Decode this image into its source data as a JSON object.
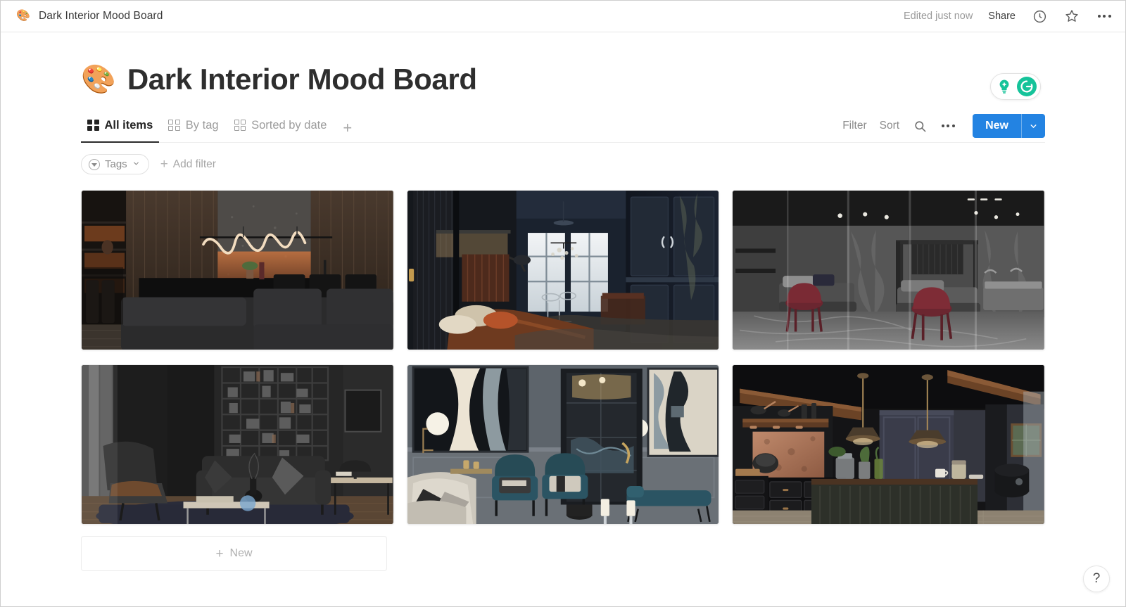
{
  "window": {
    "tab_title": "Dark Interior Mood Board",
    "favicon_icon": "artist-palette-emoji",
    "edited_status": "Edited just now",
    "share_label": "Share",
    "history_icon": "clock-icon",
    "favorite_icon": "star-icon",
    "more_icon": "ellipsis-icon"
  },
  "header": {
    "emoji": "🎨",
    "title": "Dark Interior Mood Board"
  },
  "assistant_widget": {
    "bulb_icon": "lightbulb-icon",
    "grammarly_letter": "G",
    "accent_color": "#15c39a"
  },
  "views": {
    "tabs": [
      {
        "label": "All items",
        "icon": "gallery-grid-icon",
        "active": true
      },
      {
        "label": "By tag",
        "icon": "gallery-grid-icon",
        "active": false
      },
      {
        "label": "Sorted by date",
        "icon": "gallery-grid-icon",
        "active": false
      }
    ],
    "add_view_label": "+"
  },
  "toolbar": {
    "filter_label": "Filter",
    "sort_label": "Sort",
    "search_icon": "search-icon",
    "more_icon": "ellipsis-icon",
    "new_label": "New",
    "new_caret_icon": "chevron-down-icon",
    "accent_color": "#2383e2"
  },
  "filter_bar": {
    "tag_filter_label": "Tags",
    "tag_filter_icon": "filled-circle-caret-icon",
    "tag_caret_icon": "chevron-down-icon",
    "add_filter_label": "Add filter",
    "add_filter_icon": "plus-icon"
  },
  "gallery": {
    "items": [
      {
        "name": "dark-living-kitchen-neon-pendant"
      },
      {
        "name": "dark-bedroom-rust-bedding"
      },
      {
        "name": "grey-stone-glass-bedroom"
      },
      {
        "name": "dark-lounge-bookshelf"
      },
      {
        "name": "teal-velvet-salon-abstract-art"
      },
      {
        "name": "dark-rustic-kitchen-copper"
      }
    ],
    "new_card_label": "New",
    "new_card_icon": "plus-icon"
  },
  "help": {
    "label": "?"
  }
}
